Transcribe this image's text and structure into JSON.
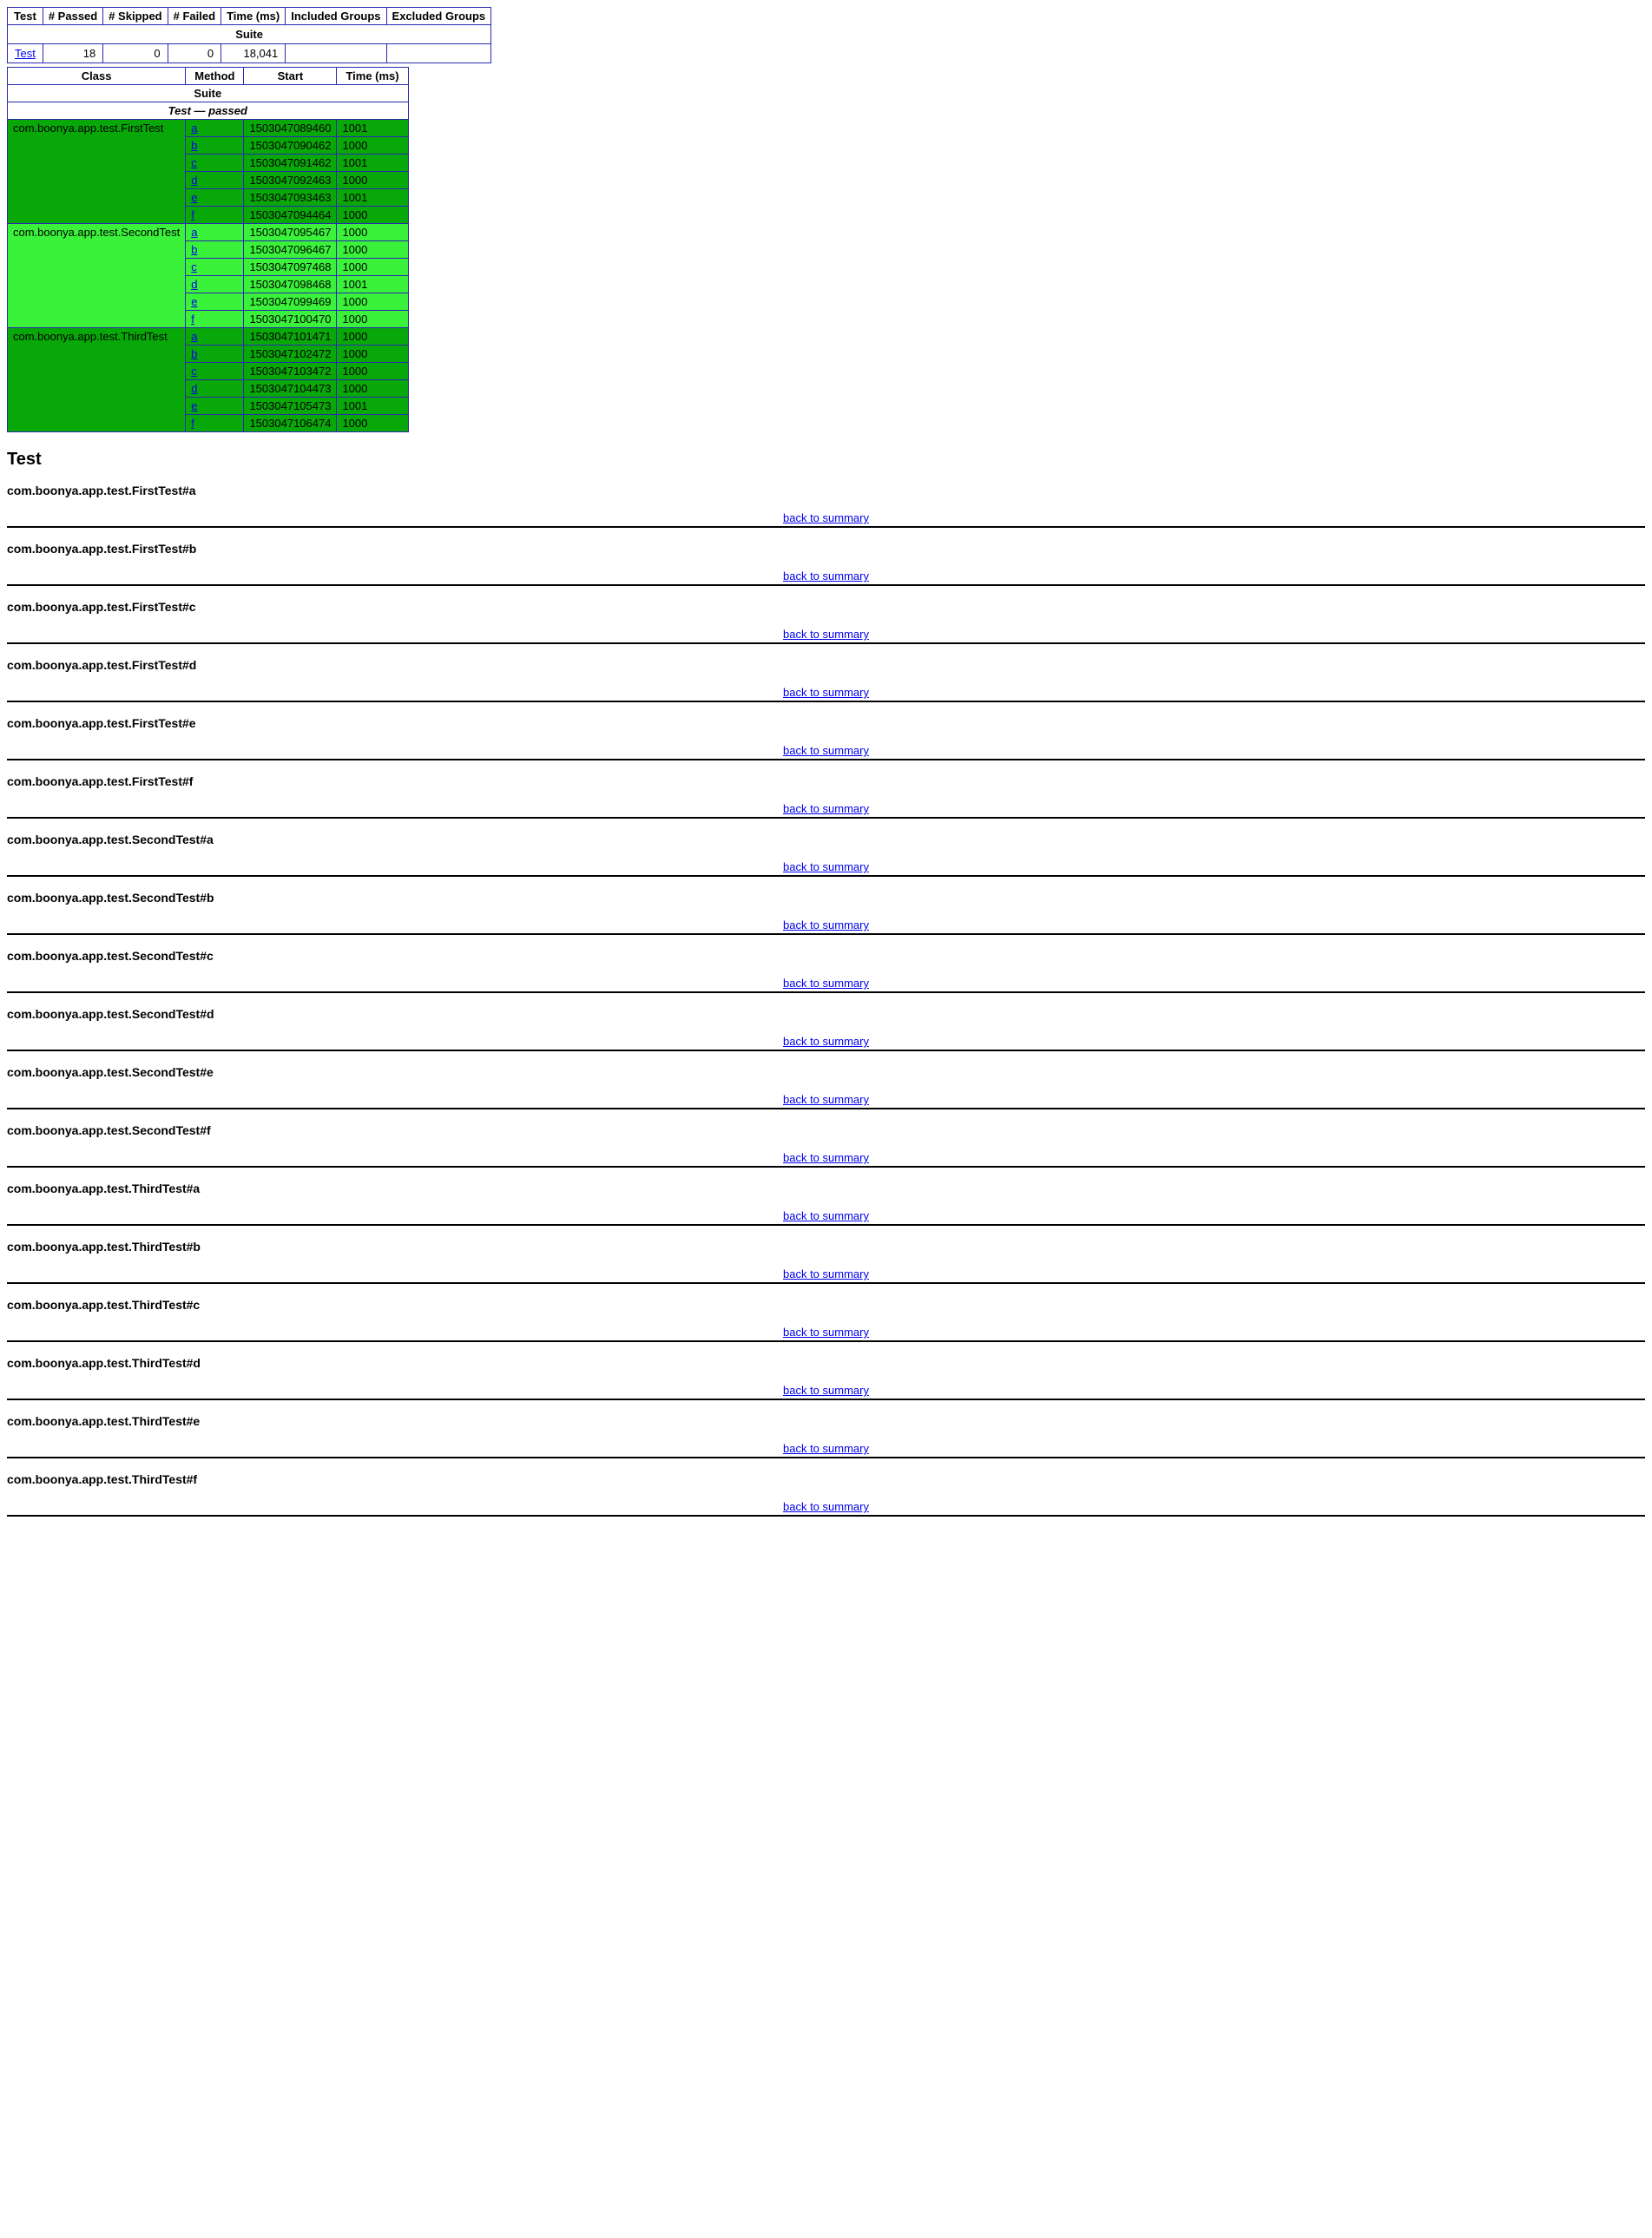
{
  "summary": {
    "headers": {
      "test": "Test",
      "passed": "# Passed",
      "skipped": "# Skipped",
      "failed": "# Failed",
      "time": "Time (ms)",
      "incGroups": "Included Groups",
      "excGroups": "Excluded Groups"
    },
    "suiteLabel": "Suite",
    "row": {
      "test": "Test",
      "passed": "18",
      "skipped": "0",
      "failed": "0",
      "time": "18,041",
      "incGroups": "",
      "excGroups": ""
    }
  },
  "detail": {
    "headers": {
      "class": "Class",
      "method": "Method",
      "start": "Start",
      "time": "Time (ms)"
    },
    "suiteLabel": "Suite",
    "passLabel": "Test — passed",
    "classes": [
      {
        "name": "com.boonya.app.test.FirstTest",
        "shade": "dark",
        "methods": [
          {
            "m": "a",
            "start": "1503047089460",
            "time": "1001"
          },
          {
            "m": "b",
            "start": "1503047090462",
            "time": "1000"
          },
          {
            "m": "c",
            "start": "1503047091462",
            "time": "1001"
          },
          {
            "m": "d",
            "start": "1503047092463",
            "time": "1000"
          },
          {
            "m": "e",
            "start": "1503047093463",
            "time": "1001"
          },
          {
            "m": "f",
            "start": "1503047094464",
            "time": "1000"
          }
        ]
      },
      {
        "name": "com.boonya.app.test.SecondTest",
        "shade": "light",
        "methods": [
          {
            "m": "a",
            "start": "1503047095467",
            "time": "1000"
          },
          {
            "m": "b",
            "start": "1503047096467",
            "time": "1000"
          },
          {
            "m": "c",
            "start": "1503047097468",
            "time": "1000"
          },
          {
            "m": "d",
            "start": "1503047098468",
            "time": "1001"
          },
          {
            "m": "e",
            "start": "1503047099469",
            "time": "1000"
          },
          {
            "m": "f",
            "start": "1503047100470",
            "time": "1000"
          }
        ]
      },
      {
        "name": "com.boonya.app.test.ThirdTest",
        "shade": "dark",
        "methods": [
          {
            "m": "a",
            "start": "1503047101471",
            "time": "1000"
          },
          {
            "m": "b",
            "start": "1503047102472",
            "time": "1000"
          },
          {
            "m": "c",
            "start": "1503047103472",
            "time": "1000"
          },
          {
            "m": "d",
            "start": "1503047104473",
            "time": "1000"
          },
          {
            "m": "e",
            "start": "1503047105473",
            "time": "1001"
          },
          {
            "m": "f",
            "start": "1503047106474",
            "time": "1000"
          }
        ]
      }
    ]
  },
  "results": {
    "heading": "Test",
    "backLink": "back to summary",
    "items": [
      "com.boonya.app.test.FirstTest#a",
      "com.boonya.app.test.FirstTest#b",
      "com.boonya.app.test.FirstTest#c",
      "com.boonya.app.test.FirstTest#d",
      "com.boonya.app.test.FirstTest#e",
      "com.boonya.app.test.FirstTest#f",
      "com.boonya.app.test.SecondTest#a",
      "com.boonya.app.test.SecondTest#b",
      "com.boonya.app.test.SecondTest#c",
      "com.boonya.app.test.SecondTest#d",
      "com.boonya.app.test.SecondTest#e",
      "com.boonya.app.test.SecondTest#f",
      "com.boonya.app.test.ThirdTest#a",
      "com.boonya.app.test.ThirdTest#b",
      "com.boonya.app.test.ThirdTest#c",
      "com.boonya.app.test.ThirdTest#d",
      "com.boonya.app.test.ThirdTest#e",
      "com.boonya.app.test.ThirdTest#f"
    ]
  }
}
